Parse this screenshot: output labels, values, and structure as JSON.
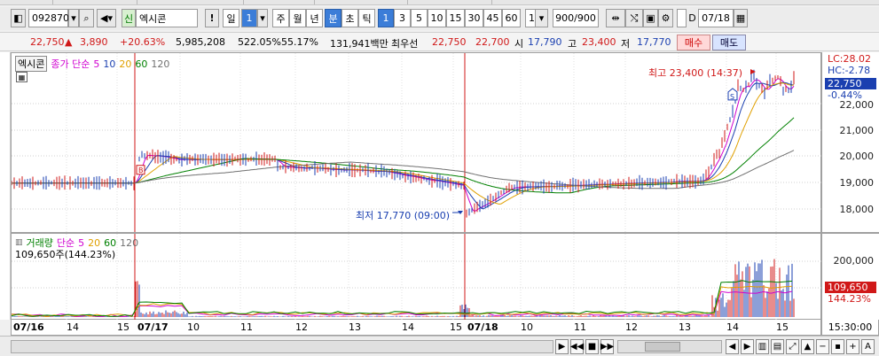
{
  "toolbar": {
    "code": "092870",
    "stock_name": "엑시콘",
    "stock_badge": "신",
    "period_labels": [
      "일",
      "주",
      "월",
      "년",
      "분",
      "초",
      "틱"
    ],
    "period_value": "1",
    "minute_options": [
      "1",
      "3",
      "5",
      "10",
      "15",
      "30",
      "45",
      "60"
    ],
    "unit_value": "1",
    "count_display": "900/900",
    "date_prefix": "D",
    "date_value": "07/18",
    "exclaim": "!"
  },
  "info": {
    "price": "22,750",
    "arrow": "▲",
    "change": "3,890",
    "change_pct": "+20.63%",
    "volume": "5,985,208",
    "volume_ratio": "522.05%",
    "turnover": "55.17%",
    "amount": "131,941백만",
    "best_label": "최우선",
    "ask": "22,750",
    "bid": "22,700",
    "open_label": "시",
    "open": "17,790",
    "high_label": "고",
    "high": "23,400",
    "low_label": "저",
    "low": "17,770",
    "buy_label": "매수",
    "sell_label": "매도"
  },
  "price_legend": {
    "name": "엑시콘",
    "kind": "종가 단순",
    "mas": [
      {
        "label": "5",
        "color": "#d000d0"
      },
      {
        "label": "10",
        "color": "#1a3fb0"
      },
      {
        "label": "20",
        "color": "#e0a000"
      },
      {
        "label": "60",
        "color": "#008000"
      },
      {
        "label": "120",
        "color": "#707070"
      }
    ]
  },
  "volume_legend": {
    "name": "거래량",
    "kind": "단순",
    "mas": [
      {
        "label": "5",
        "color": "#d000d0"
      },
      {
        "label": "20",
        "color": "#e0a000"
      },
      {
        "label": "60",
        "color": "#008000"
      },
      {
        "label": "120",
        "color": "#707070"
      }
    ],
    "current": "109,650주(144.23%)"
  },
  "annotations": {
    "high_text": "최고 23,400 (14:37)",
    "low_text": "최저 17,770 (09:00)",
    "buy_marker": "B",
    "sell_marker": "S",
    "lc": "LC:28.02",
    "hc": "HC:-2.78",
    "price_tag": "22,750",
    "price_tag_pct": "-0.44%",
    "vol_tag": "109,650",
    "vol_tag_pct": "144.23%"
  },
  "price_axis": [
    "22,000",
    "21,000",
    "20,000",
    "19,000",
    "18,000"
  ],
  "volume_axis": [
    "200,000",
    "100,000"
  ],
  "x_axis": [
    "07/16",
    "14",
    "15",
    "07/17",
    "10",
    "11",
    "12",
    "13",
    "14",
    "15",
    "07/18",
    "10",
    "11",
    "12",
    "13",
    "14",
    "15"
  ],
  "time_right": "15:30:00",
  "colors": {
    "up": "#d01818",
    "down": "#1a3fb0",
    "ma5": "#d000d0",
    "ma10": "#1a3fb0",
    "ma20": "#e0a000",
    "ma60": "#008000",
    "ma120": "#707070"
  }
}
